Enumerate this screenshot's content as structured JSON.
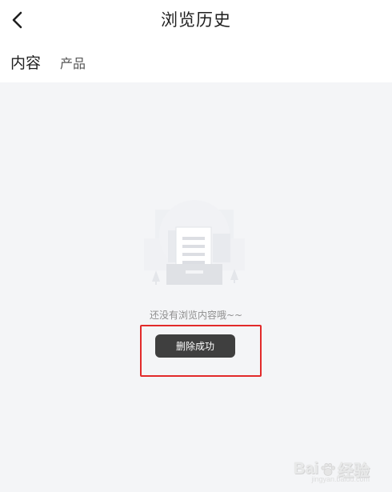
{
  "header": {
    "title": "浏览历史",
    "back_icon": "chevron-left-icon"
  },
  "tabs": [
    {
      "label": "内容",
      "active": true
    },
    {
      "label": "产品",
      "active": false
    }
  ],
  "empty_state": {
    "illustration": "empty-document-box-illustration",
    "message": "还没有浏览内容哦~~"
  },
  "toast": {
    "message": "删除成功"
  },
  "annotation": {
    "color": "#e22a2a"
  },
  "watermark": {
    "text_before": "Bai",
    "text_after": "经验",
    "sub": "jingyan.baidu.com"
  }
}
